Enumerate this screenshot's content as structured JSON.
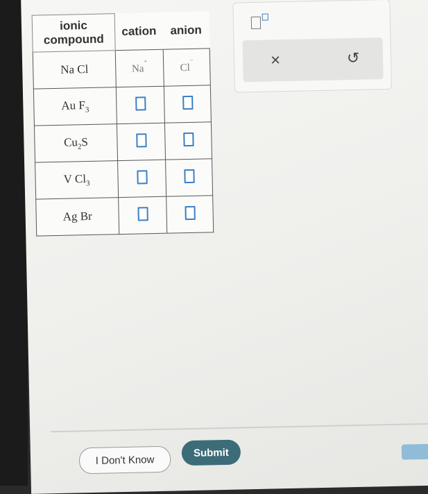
{
  "table": {
    "headers": [
      "ionic compound",
      "cation",
      "anion"
    ],
    "header_compound_line1": "ionic",
    "header_compound_line2": "compound",
    "rows": [
      {
        "formula_base": "Na Cl",
        "subscript": "",
        "subscript_pos": "none",
        "cation": "Na",
        "cation_charge": "+",
        "anion": "Cl",
        "anion_charge": "−",
        "filled": true
      },
      {
        "formula_base": "Au F",
        "subscript": "3",
        "subscript_pos": "end",
        "cation": "",
        "anion": "",
        "filled": false
      },
      {
        "formula_base": "Cu",
        "formula_tail": "S",
        "subscript": "2",
        "subscript_pos": "middle",
        "cation": "",
        "anion": "",
        "filled": false
      },
      {
        "formula_base": "V Cl",
        "subscript": "3",
        "subscript_pos": "end",
        "cation": "",
        "anion": "",
        "filled": false
      },
      {
        "formula_base": "Ag Br",
        "subscript": "",
        "subscript_pos": "none",
        "cation": "",
        "anion": "",
        "filled": false
      }
    ]
  },
  "tools": {
    "superscript_icon": "superscript-box-icon",
    "clear_icon": "×",
    "undo_icon": "↺"
  },
  "buttons": {
    "dont_know": "I Don't Know",
    "submit": "Submit"
  },
  "colors": {
    "accent": "#3b7fc4",
    "submit_bg": "#3c6c78"
  }
}
